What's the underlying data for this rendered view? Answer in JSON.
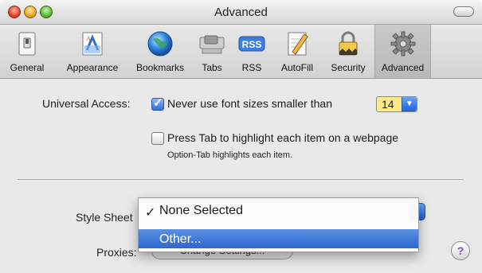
{
  "window": {
    "title": "Advanced"
  },
  "toolbar": {
    "items": [
      {
        "label": "General",
        "icon": "light-switch-icon"
      },
      {
        "label": "Appearance",
        "icon": "font-document-icon"
      },
      {
        "label": "Bookmarks",
        "icon": "globe-icon"
      },
      {
        "label": "Tabs",
        "icon": "tabs-icon"
      },
      {
        "label": "RSS",
        "icon": "rss-icon"
      },
      {
        "label": "AutoFill",
        "icon": "pencil-document-icon"
      },
      {
        "label": "Security",
        "icon": "lock-icon"
      },
      {
        "label": "Advanced",
        "icon": "gear-icon"
      }
    ],
    "selected": "Advanced",
    "rss_badge": "RSS"
  },
  "universal_access": {
    "label": "Universal Access:",
    "font_size_checkbox_label": "Never use font sizes smaller than",
    "font_size_value": "14",
    "font_size_checked": true,
    "tab_checkbox_label": "Press Tab to highlight each item on a webpage",
    "tab_checked": false,
    "tab_note": "Option-Tab highlights each item."
  },
  "style_sheet": {
    "label": "Style Sheet",
    "menu": {
      "items": [
        "None Selected",
        "Other..."
      ],
      "selected": "None Selected",
      "highlighted": "Other...",
      "check_glyph": "✓"
    }
  },
  "proxies": {
    "label": "Proxies:",
    "button_label": "Change Settings..."
  },
  "help": {
    "glyph": "?"
  }
}
